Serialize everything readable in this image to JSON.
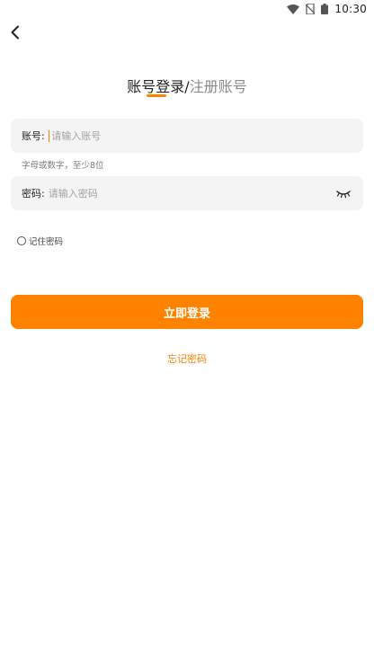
{
  "status_bar": {
    "time": "10:30",
    "icons": [
      "wifi-icon",
      "no-sim-icon",
      "battery-icon"
    ]
  },
  "header": {
    "back_icon": "chevron-left-icon"
  },
  "tabs": {
    "login_label": "账号登录",
    "separator": "/",
    "register_label": "注册账号",
    "active": "login"
  },
  "form": {
    "account": {
      "label": "账号:",
      "placeholder": "请输入账号",
      "value": "",
      "hint": "字母或数字，至少8位"
    },
    "password": {
      "label": "密码:",
      "placeholder": "请输入密码",
      "value": "",
      "toggle_icon": "eye-closed-icon"
    },
    "remember_label": "记住密码",
    "remember_checked": false,
    "submit_label": "立即登录",
    "forgot_label": "忘记密码"
  },
  "colors": {
    "accent": "#ff8200",
    "field_bg": "#f4f4f4",
    "muted_text": "#8a8a8a"
  }
}
